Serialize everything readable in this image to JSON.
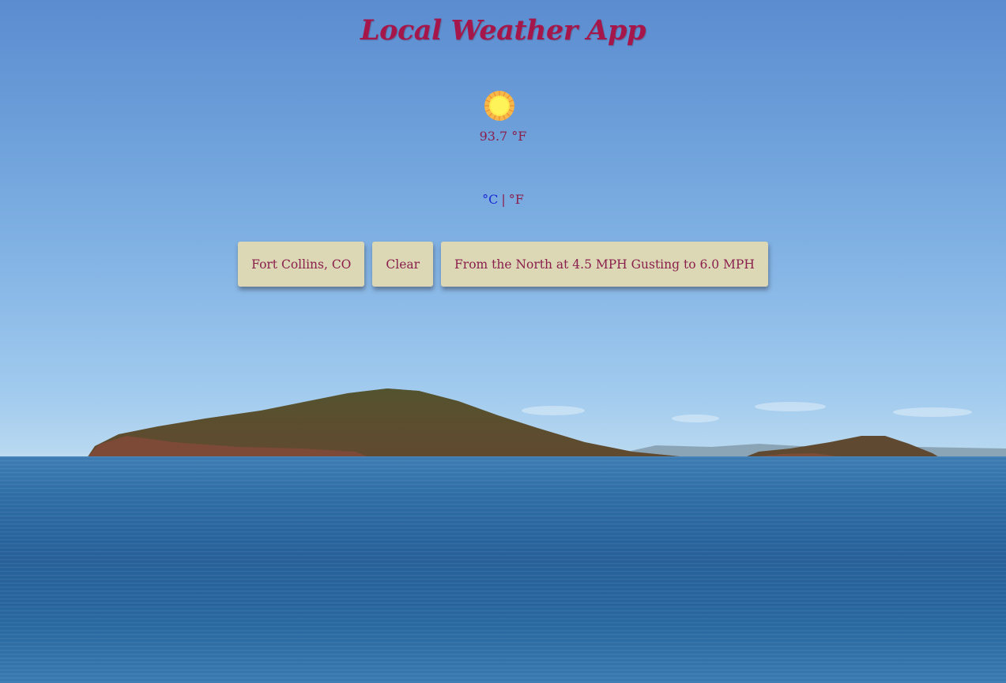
{
  "header": {
    "title": "Local Weather App"
  },
  "current": {
    "icon": "sun-icon",
    "temperature": "93.7 °F"
  },
  "units": {
    "celsius_label": "°C",
    "separator": "|",
    "fahrenheit_label": "°F"
  },
  "buttons": {
    "location_label": "Fort Collins, CO",
    "clear_label": "Clear",
    "wind_label": "From the North at 4.5 MPH Gusting to 6.0 MPH"
  },
  "colors": {
    "title": "#a5174a",
    "text": "#8a1f4c",
    "celsius_link": "#1a2bd6",
    "button_bg": "#dcd7b5"
  }
}
